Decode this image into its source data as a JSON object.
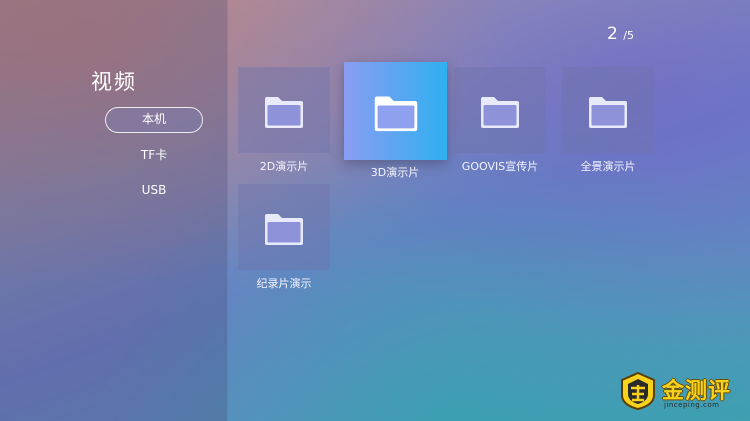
{
  "pager": {
    "current": "2",
    "total": "/5"
  },
  "sidebar": {
    "title": "视频",
    "items": [
      {
        "label": "本机",
        "active": true
      },
      {
        "label": "TF卡",
        "active": false
      },
      {
        "label": "USB",
        "active": false
      }
    ]
  },
  "folders": [
    {
      "label": "2D演示片",
      "selected": false
    },
    {
      "label": "3D演示片",
      "selected": true
    },
    {
      "label": "GOOVIS宣传片",
      "selected": false
    },
    {
      "label": "全景演示片",
      "selected": false
    },
    {
      "label": "纪录片演示",
      "selected": false
    }
  ],
  "icons": {
    "folder": "folder-icon",
    "watermark_logo": "gold-badge-icon"
  },
  "colors": {
    "selected_start": "#8a9cf2",
    "selected_end": "#2fb0ef",
    "watermark": "#f7d21c"
  },
  "watermark": {
    "text": "金测评",
    "url": "jinceping.com"
  }
}
